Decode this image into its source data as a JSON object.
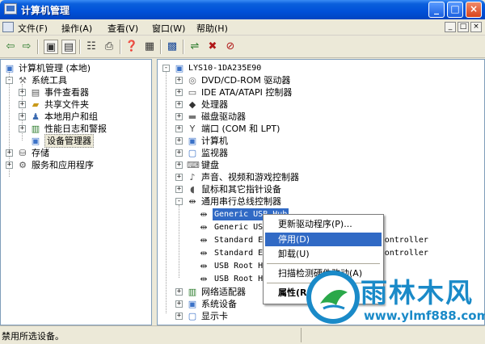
{
  "window": {
    "title": "计算机管理"
  },
  "title_buttons": {
    "minimize": "_",
    "maximize": "□",
    "close": "×"
  },
  "menubar": {
    "items": [
      "文件(F)",
      "操作(A)",
      "查看(V)",
      "窗口(W)",
      "帮助(H)"
    ],
    "mdi_buttons": [
      "_",
      "□",
      "×"
    ]
  },
  "left_tree": [
    {
      "label": "计算机管理 (本地)",
      "icon": "computer-management-icon",
      "expander": ""
    },
    {
      "label": "系统工具",
      "icon": "tools-icon",
      "expander": "-"
    },
    {
      "label": "事件查看器",
      "icon": "event-viewer-icon",
      "expander": "+"
    },
    {
      "label": "共享文件夹",
      "icon": "shared-folder-icon",
      "expander": "+"
    },
    {
      "label": "本地用户和组",
      "icon": "users-icon",
      "expander": "+"
    },
    {
      "label": "性能日志和警报",
      "icon": "performance-icon",
      "expander": "+"
    },
    {
      "label": "设备管理器",
      "icon": "device-manager-icon",
      "expander": "",
      "selected": true
    },
    {
      "label": "存储",
      "icon": "storage-icon",
      "expander": "+"
    },
    {
      "label": "服务和应用程序",
      "icon": "services-icon",
      "expander": "+"
    }
  ],
  "right_tree": {
    "root": "LYS10-1DA235E90",
    "categories": [
      {
        "label": "DVD/CD-ROM 驱动器",
        "icon": "dvd-icon",
        "expander": "+"
      },
      {
        "label": "IDE ATA/ATAPI 控制器",
        "icon": "ide-icon",
        "expander": "+"
      },
      {
        "label": "处理器",
        "icon": "processor-icon",
        "expander": "+"
      },
      {
        "label": "磁盘驱动器",
        "icon": "disk-icon",
        "expander": "+"
      },
      {
        "label": "端口 (COM 和 LPT)",
        "icon": "port-icon",
        "expander": "+"
      },
      {
        "label": "计算机",
        "icon": "computer-icon",
        "expander": "+"
      },
      {
        "label": "监视器",
        "icon": "monitor-icon",
        "expander": "+"
      },
      {
        "label": "键盘",
        "icon": "keyboard-icon",
        "expander": "+"
      },
      {
        "label": "声音、视频和游戏控制器",
        "icon": "sound-icon",
        "expander": "+"
      },
      {
        "label": "鼠标和其它指针设备",
        "icon": "mouse-icon",
        "expander": "+"
      },
      {
        "label": "通用串行总线控制器",
        "icon": "usb-icon",
        "expander": "-"
      }
    ],
    "usb_children": [
      {
        "label": "Generic USB Hub",
        "selected": true
      },
      {
        "label": "Generic USB Hub"
      },
      {
        "label": "Standard Enhanced PCI to USB Host Controller"
      },
      {
        "label": "Standard Enhanced PCI to USB Host Controller"
      },
      {
        "label": "USB Root Hub"
      },
      {
        "label": "USB Root Hub"
      }
    ],
    "tail_categories": [
      {
        "label": "网络适配器",
        "icon": "network-adapter-icon",
        "expander": "+"
      },
      {
        "label": "系统设备",
        "icon": "system-device-icon",
        "expander": "+"
      },
      {
        "label": "显示卡",
        "icon": "display-adapter-icon",
        "expander": "+"
      }
    ]
  },
  "context_menu": {
    "update_driver": "更新驱动程序(P)...",
    "disable": "停用(D)",
    "uninstall": "卸载(U)",
    "scan": "扫描检测硬件改动(A)",
    "properties": "属性(R)"
  },
  "status": {
    "text": "禁用所选设备。"
  },
  "watermark": {
    "title": "雨林木风",
    "url": "www.ylmf888.com"
  },
  "colors": {
    "selection": "#316ac5",
    "titlebar": "#0050d8",
    "watermark": "#1a8ac8"
  }
}
